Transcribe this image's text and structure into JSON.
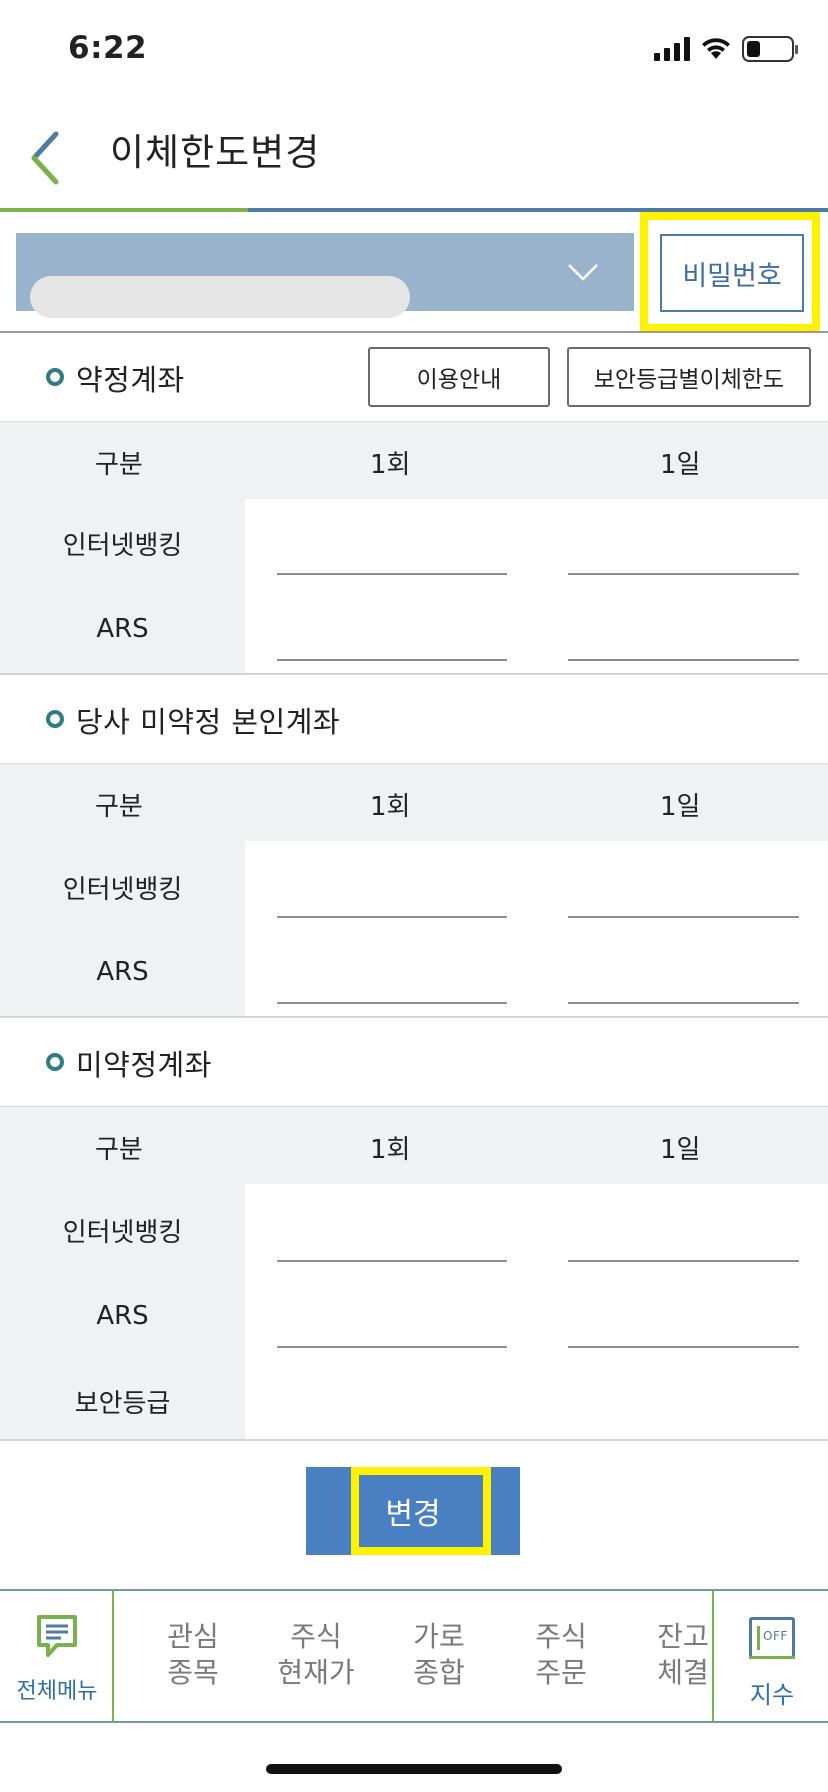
{
  "status_bar": {
    "time": "6:22",
    "battery_level": 0.3
  },
  "header": {
    "title": "이체한도변경"
  },
  "account": {
    "password_button": "비밀번호"
  },
  "sections": [
    {
      "title": "약정계좌",
      "buttons": [
        "이용안내",
        "보안등급별이체한도"
      ],
      "columns": [
        "구분",
        "1회",
        "1일"
      ],
      "rows": [
        "인터넷뱅킹",
        "ARS"
      ]
    },
    {
      "title": "당사 미약정 본인계좌",
      "columns": [
        "구분",
        "1회",
        "1일"
      ],
      "rows": [
        "인터넷뱅킹",
        "ARS"
      ]
    },
    {
      "title": "미약정계좌",
      "columns": [
        "구분",
        "1회",
        "1일"
      ],
      "rows": [
        "인터넷뱅킹",
        "ARS",
        "보안등급"
      ]
    }
  ],
  "change_button": "변경",
  "bottom_nav": {
    "menu": "전체메뉴",
    "items": [
      {
        "line1": "관심",
        "line2": "종목"
      },
      {
        "line1": "주식",
        "line2": "현재가"
      },
      {
        "line1": "가로",
        "line2": "종합"
      },
      {
        "line1": "주식",
        "line2": "주문"
      },
      {
        "line1": "잔고",
        "line2": "체결"
      }
    ],
    "index_label": "지수",
    "index_icon_text": "OFF"
  },
  "colors": {
    "accent_blue": "#4a7fc1",
    "account_bar": "#9ab3cc",
    "highlight": "#fff200",
    "accent_green": "#79b14c"
  }
}
